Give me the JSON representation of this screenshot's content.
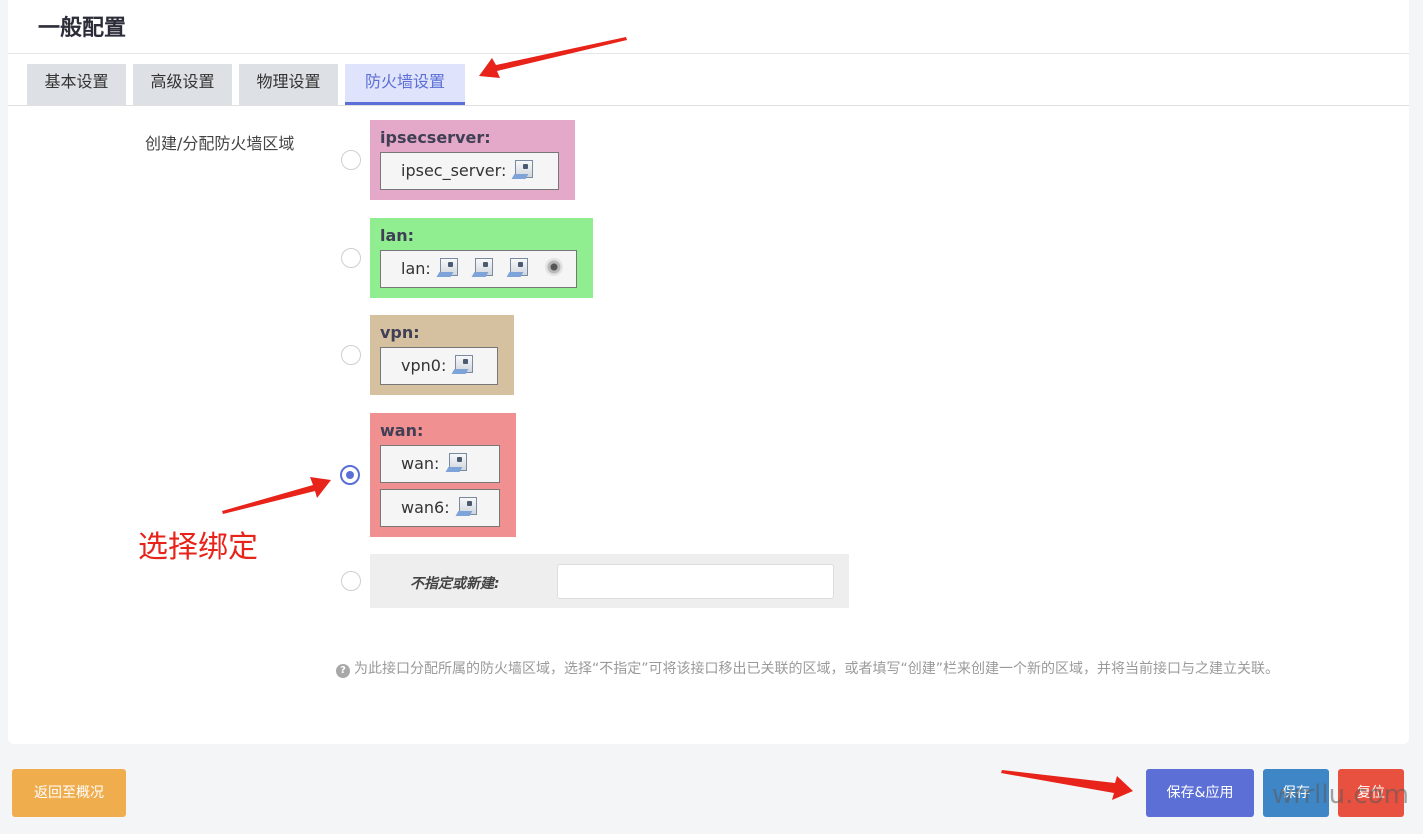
{
  "page": {
    "title": "一般配置"
  },
  "tabs": [
    {
      "label": "基本设置",
      "active": false
    },
    {
      "label": "高级设置",
      "active": false
    },
    {
      "label": "物理设置",
      "active": false
    },
    {
      "label": "防火墙设置",
      "active": true
    }
  ],
  "firewall": {
    "field_label": "创建/分配防火墙区域",
    "zones": [
      {
        "name": "ipsecserver:",
        "color": "#e4a8c8",
        "selected": false,
        "interfaces": [
          {
            "label": "ipsec_server:",
            "icons": [
              "ethernet-port-icon"
            ]
          }
        ]
      },
      {
        "name": "lan:",
        "color": "#90ee90",
        "selected": false,
        "interfaces": [
          {
            "label": "lan:",
            "icons": [
              "ethernet-port-icon",
              "ethernet-port-icon",
              "ethernet-port-icon",
              "wireless-icon"
            ]
          }
        ]
      },
      {
        "name": "vpn:",
        "color": "#d5c0a0",
        "selected": false,
        "interfaces": [
          {
            "label": "vpn0:",
            "icons": [
              "ethernet-port-icon"
            ]
          }
        ]
      },
      {
        "name": "wan:",
        "color": "#f09090",
        "selected": true,
        "interfaces": [
          {
            "label": "wan:",
            "icons": [
              "ethernet-port-icon"
            ]
          },
          {
            "label": "wan6:",
            "icons": [
              "ethernet-port-icon"
            ]
          }
        ]
      }
    ],
    "unspecified": {
      "label": "不指定或新建:",
      "value": "",
      "placeholder": "",
      "selected": false
    },
    "help_text": "为此接口分配所属的防火墙区域，选择“不指定”可将该接口移出已关联的区域，或者填写“创建”栏来创建一个新的区域，并将当前接口与之建立关联。",
    "help_icon": "question-circle-icon"
  },
  "annotation": {
    "text": "选择绑定",
    "color": "#e8231a"
  },
  "footer": {
    "back_label": "返回至概况",
    "save_apply_label": "保存&应用",
    "save_label": "保存",
    "reset_label": "复位"
  },
  "watermark": "wrrllu.com",
  "colors": {
    "accent": "#5b6fd6",
    "warning": "#f0ad4e",
    "primary": "#3f86c7",
    "danger": "#e8513f"
  }
}
